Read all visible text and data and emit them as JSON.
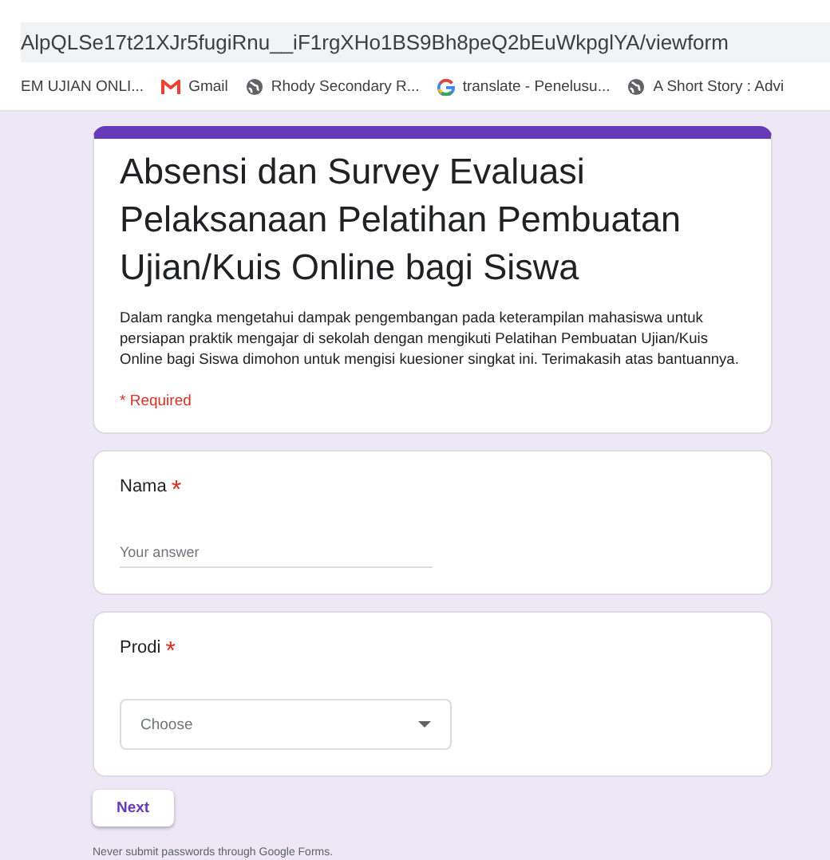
{
  "address_bar": {
    "url": "AlpQLSe17t21XJr5fugiRnu__iF1rgXHo1BS9Bh8peQ2bEuWkpglYA/viewform"
  },
  "bookmarks": [
    {
      "label": "EM UJIAN ONLI...",
      "kind": "none"
    },
    {
      "label": "Gmail",
      "kind": "gmail"
    },
    {
      "label": "Rhody Secondary R...",
      "kind": "globe"
    },
    {
      "label": "translate - Penelusu...",
      "kind": "google"
    },
    {
      "label": "A Short Story : Advi",
      "kind": "globe"
    }
  ],
  "form": {
    "title": "Absensi dan Survey Evaluasi Pelaksanaan Pelatihan Pembuatan Ujian/Kuis Online bagi Siswa",
    "description": "Dalam rangka mengetahui dampak pengembangan pada keterampilan mahasiswa untuk persiapan praktik mengajar di sekolah dengan mengikuti Pelatihan Pembuatan Ujian/Kuis Online bagi Siswa dimohon untuk mengisi kuesioner singkat ini. Terimakasih atas bantuannya.",
    "required_note": "* Required",
    "required_mark": "*",
    "questions": [
      {
        "kind": "text",
        "label": "Nama",
        "required": true,
        "placeholder": "Your answer"
      },
      {
        "kind": "dropdown",
        "label": "Prodi",
        "required": true,
        "placeholder": "Choose"
      }
    ],
    "next_button": "Next",
    "footer": "Never submit passwords through Google Forms."
  }
}
